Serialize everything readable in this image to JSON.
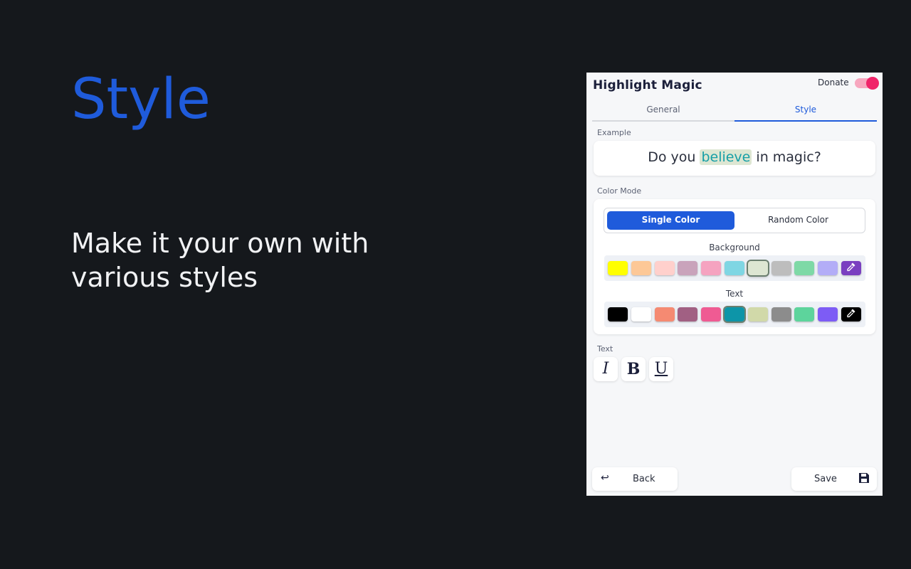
{
  "hero": {
    "title": "Style",
    "subtitle": "Make it your own with various styles"
  },
  "header": {
    "app_title": "Highlight Magic",
    "donate_label": "Donate",
    "toggle_on": true
  },
  "tabs": [
    {
      "label": "General",
      "active": false
    },
    {
      "label": "Style",
      "active": true
    }
  ],
  "example": {
    "label": "Example",
    "before": "Do you ",
    "highlighted": "believe",
    "after": " in magic?"
  },
  "color_mode": {
    "label": "Color Mode",
    "options": [
      "Single Color",
      "Random Color"
    ],
    "selected": "Single Color",
    "background_label": "Background",
    "text_label": "Text",
    "background_swatches": [
      "#ffff00",
      "#fdc897",
      "#ffd0cc",
      "#c9a3bb",
      "#f5a3c0",
      "#7fd6e3",
      "#dde6d2",
      "#bdbdbd",
      "#7ed9a6",
      "#b3adf7",
      "#7a3fc0"
    ],
    "background_selected_index": 6,
    "text_swatches": [
      "#000000",
      "#ffffff",
      "#f58a72",
      "#a16083",
      "#ef5b93",
      "#0d95a8",
      "#d1d9a9",
      "#8c8c8c",
      "#5dd49c",
      "#7d5cf5",
      "#000000"
    ],
    "text_selected_index": 5
  },
  "text_style": {
    "label": "Text",
    "italic": "I",
    "bold": "B",
    "underline": "U"
  },
  "footer": {
    "back_label": "Back",
    "save_label": "Save"
  },
  "colors": {
    "accent": "#1f5bdb",
    "toggle": "#f0246a",
    "highlight_text": "#169fa6"
  }
}
